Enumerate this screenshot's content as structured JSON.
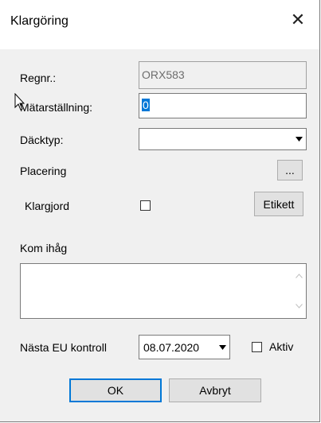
{
  "window": {
    "title": "Klargöring",
    "close_glyph": "✕"
  },
  "regnr": {
    "label": "Regnr.:",
    "value": "ORX583"
  },
  "matarstallning": {
    "label": "Mätarställning:",
    "value": "0"
  },
  "dacktyp": {
    "label": "Däcktyp:",
    "value": ""
  },
  "placering": {
    "label": "Placering",
    "button_label": "..."
  },
  "klargjord": {
    "label": "Klargjord",
    "checked": false,
    "button_label": "Etikett"
  },
  "kom_ihag": {
    "label": "Kom ihåg",
    "value": ""
  },
  "nasta_eu": {
    "label": "Nästa EU kontroll",
    "date": "08.07.2020",
    "aktiv_label": "Aktiv",
    "aktiv_checked": false
  },
  "buttons": {
    "ok": "OK",
    "cancel": "Avbryt"
  },
  "icons": {
    "close": "close-icon",
    "dropdown": "chevron-down-icon",
    "cursor": "mouse-pointer-icon"
  }
}
